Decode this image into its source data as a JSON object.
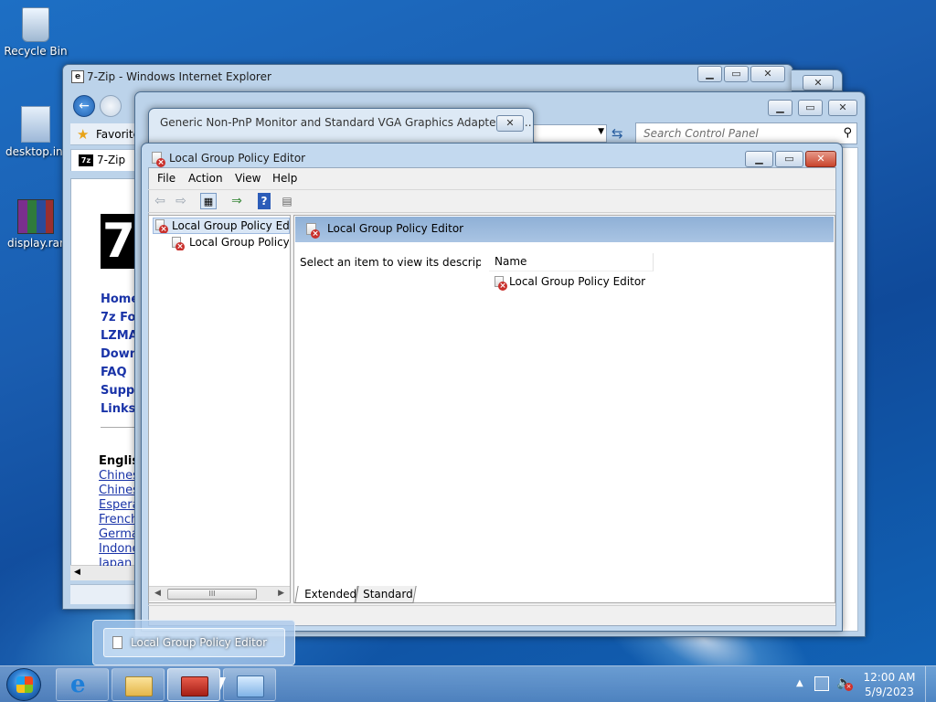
{
  "desktop": {
    "icons": [
      {
        "label": "Recycle Bin",
        "icon": "recycle-bin-icon"
      },
      {
        "label": "desktop.ini",
        "icon": "settings-file-icon"
      },
      {
        "label": "display.rar",
        "icon": "winrar-archive-icon"
      }
    ]
  },
  "ie_window": {
    "title": "7-Zip - Windows Internet Explorer",
    "favorites_label": "Favorite",
    "tab_label": "7-Zip",
    "logo_text": "7",
    "links": [
      "Home",
      "7z Fo",
      "LZMA",
      "Down",
      "FAQ",
      "Supp",
      "Links"
    ],
    "lang_heading": "Englis",
    "languages": [
      "Chines",
      "Chines",
      "Espera",
      "French",
      "Germa",
      "Indone",
      "Japan"
    ]
  },
  "monitor_window": {
    "title": "Generic Non-PnP Monitor and Standard VGA Graphics Adapter Pro..."
  },
  "control_panel_window": {
    "search_placeholder": "Search Control Panel"
  },
  "gpe_window": {
    "title": "Local Group Policy Editor",
    "menu": [
      "File",
      "Action",
      "View",
      "Help"
    ],
    "tree": [
      {
        "label": "Local Group Policy Editor",
        "selected": true
      },
      {
        "label": "Local Group Policy Editor",
        "selected": false
      }
    ],
    "header_title": "Local Group Policy Editor",
    "description": "Select an item to view its description.",
    "column_name": "Name",
    "items": [
      "Local Group Policy Editor"
    ],
    "tabs": [
      "Extended",
      "Standard"
    ],
    "scroll_thumb": "III"
  },
  "taskbar": {
    "thumbnail_label": "Local Group Policy Editor",
    "apps": [
      {
        "icon": "internet-explorer-icon"
      },
      {
        "icon": "file-explorer-icon"
      },
      {
        "icon": "toolbox-icon",
        "active": true
      },
      {
        "icon": "control-panel-icon"
      }
    ],
    "time": "12:00 AM",
    "date": "5/9/2023"
  }
}
